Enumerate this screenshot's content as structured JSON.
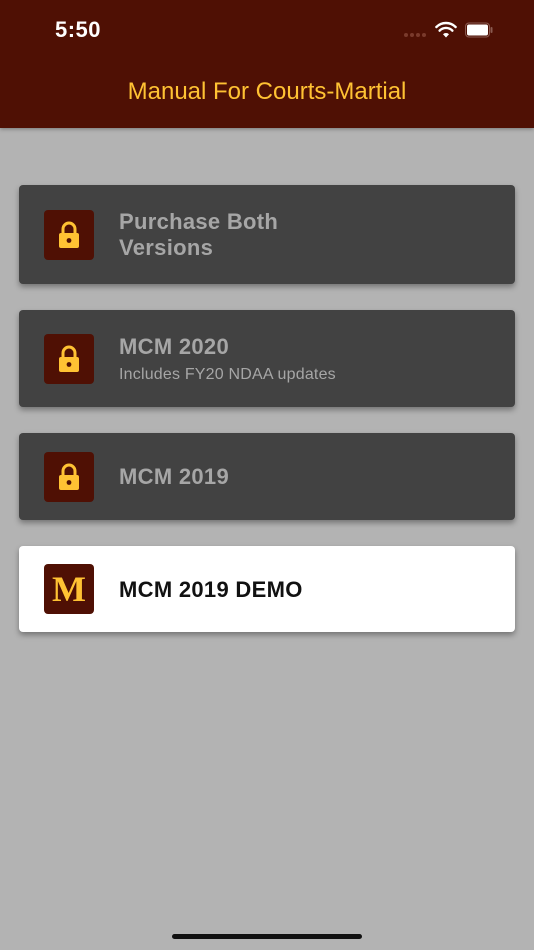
{
  "status_bar": {
    "time": "5:50"
  },
  "nav": {
    "title": "Manual For Courts-Martial"
  },
  "colors": {
    "header_bg": "#4f1004",
    "accent": "#ffc233",
    "page_bg": "#b3b3b3",
    "card_locked_bg": "#424242",
    "card_unlocked_bg": "#ffffff"
  },
  "items": [
    {
      "title_line1": "Purchase Both",
      "title_line2": "Versions",
      "icon": "lock-icon",
      "locked": true
    },
    {
      "title": "MCM 2020",
      "subtitle": "Includes FY20 NDAA updates",
      "icon": "lock-icon",
      "locked": true
    },
    {
      "title": "MCM 2019",
      "icon": "lock-icon",
      "locked": true
    },
    {
      "title": "MCM 2019 DEMO",
      "icon": "m-logo-icon",
      "icon_letter": "M",
      "locked": false
    }
  ]
}
